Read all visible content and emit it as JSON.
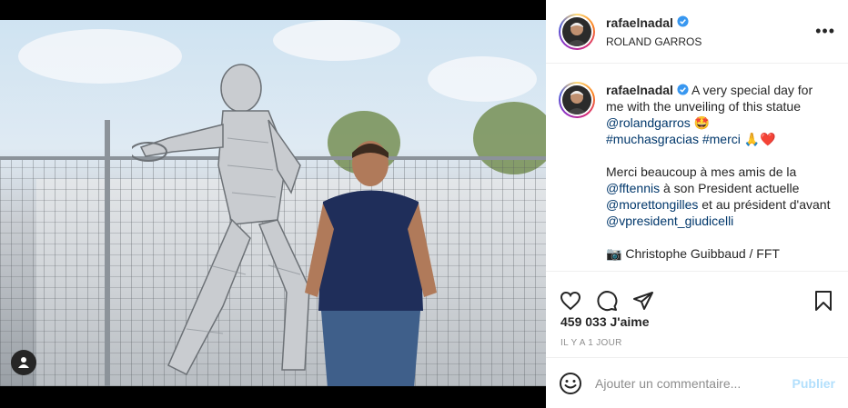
{
  "post": {
    "username": "rafaelnadal",
    "location": "ROLAND GARROS",
    "more_icon": "more-horizontal-icon"
  },
  "caption": {
    "username": "rafaelnadal",
    "line1_text": " A very special day for me with the unveiling of this statue ",
    "mention_rolandgarros": "@rolandgarros",
    "emoji_star_eyes": "🤩",
    "hashtag_muchasgracias": "#muchasgracias",
    "hashtag_merci": "#merci",
    "emoji_pray": "🙏",
    "emoji_heart": "❤️",
    "para2_a": "Merci beaucoup à mes amis de la ",
    "mention_fftennis": "@fftennis",
    "para2_b": " à son President actuelle ",
    "mention_morettongilles": "@morettongilles",
    "para2_c": " et au président d'avant ",
    "mention_vpresident": "@vpresident_giudicelli",
    "credit_emoji": "📷",
    "credit_text": " Christophe Guibbaud / FFT"
  },
  "stats": {
    "likes": "459 033 J'aime",
    "time": "IL Y A 1 JOUR"
  },
  "comment": {
    "placeholder": "Ajouter un commentaire...",
    "publish_label": "Publier"
  },
  "colors": {
    "link": "#00376b",
    "publish_disabled": "#b2dffc",
    "verified": "#3897f0",
    "heart": "#ed4956"
  }
}
